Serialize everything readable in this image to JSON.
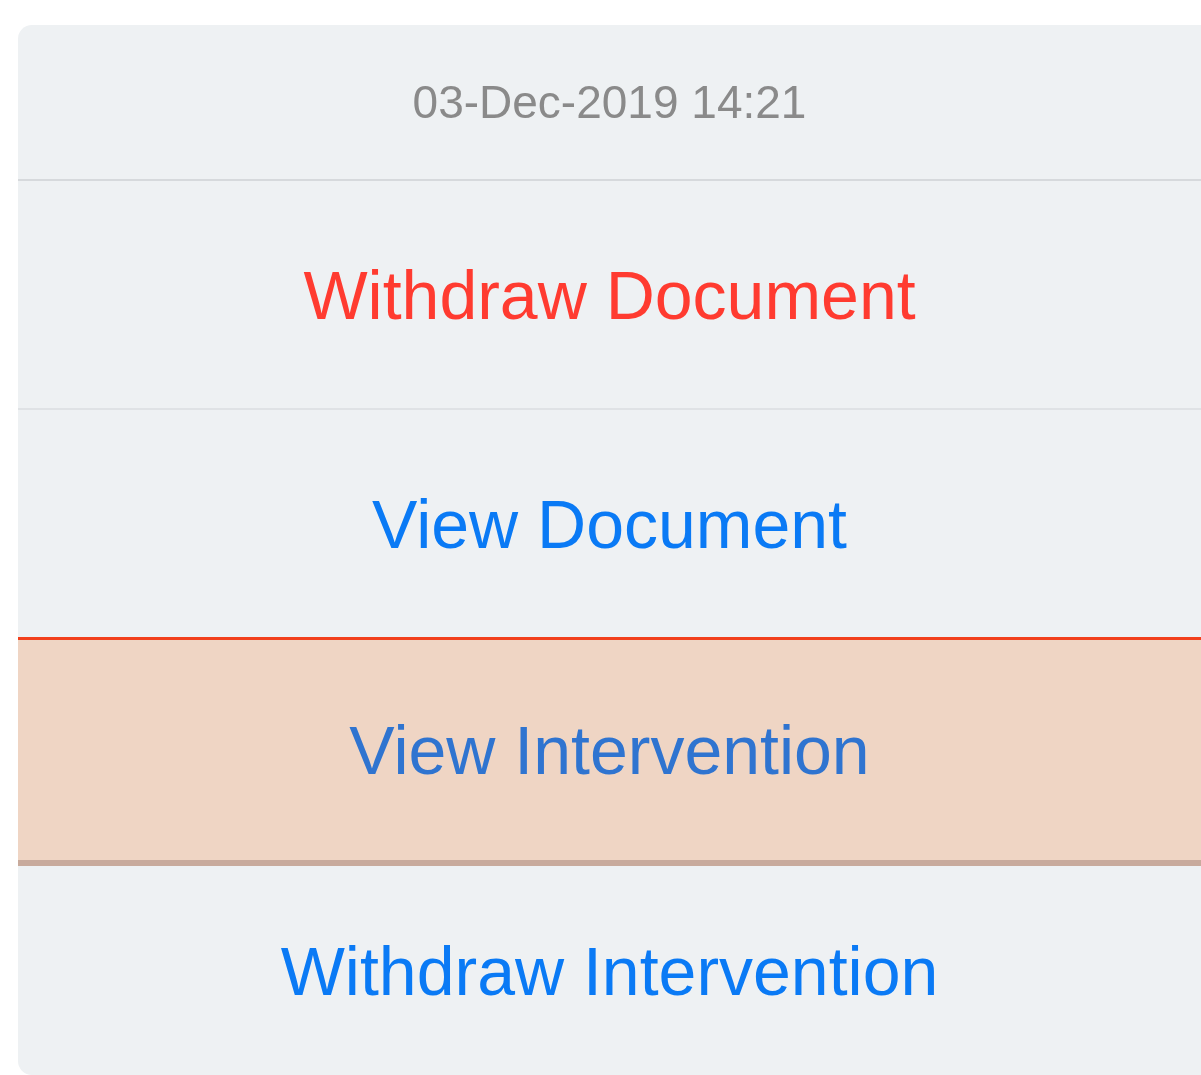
{
  "action_sheet": {
    "title": "03-Dec-2019 14:21",
    "actions": [
      {
        "label": "Withdraw Document",
        "kind": "destructive",
        "selected": false
      },
      {
        "label": "View Document",
        "kind": "default",
        "selected": false
      },
      {
        "label": "View Intervention",
        "kind": "default",
        "selected": true
      },
      {
        "label": "Withdraw Intervention",
        "kind": "default",
        "selected": false
      }
    ]
  }
}
